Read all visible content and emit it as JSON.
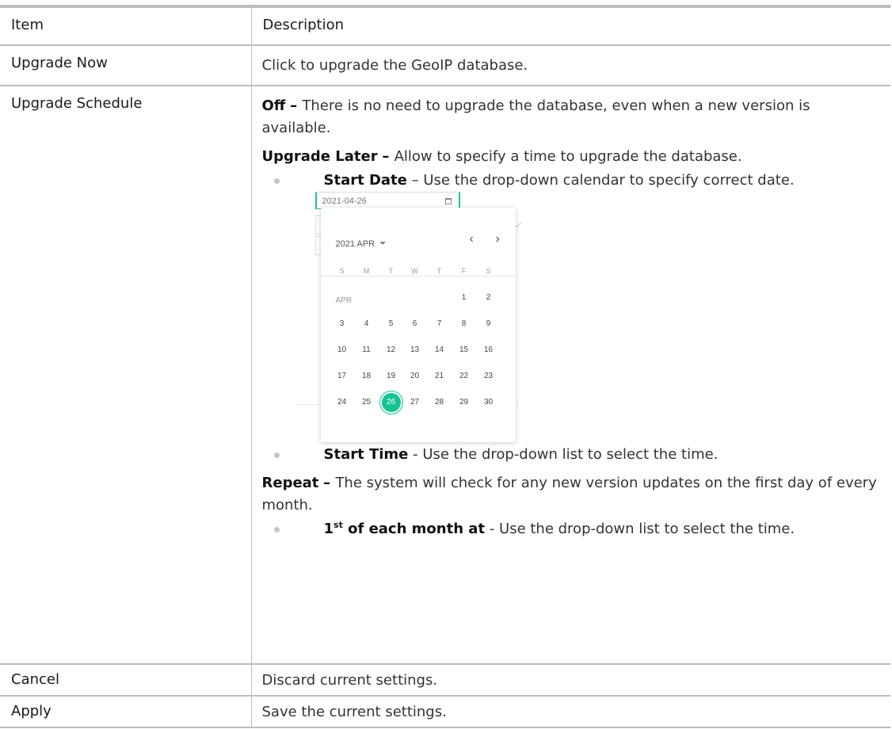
{
  "header": {
    "col_item": "Item",
    "col_description": "Description"
  },
  "rows": {
    "upgrade_now": {
      "item": "Upgrade Now",
      "desc": "Click to upgrade the GeoIP database."
    },
    "upgrade_schedule": {
      "item": "Upgrade Schedule",
      "off_label": "Off",
      "off_text": "There is no need to upgrade the database, even when a new version is available.",
      "later_label": "Upgrade Later",
      "later_text": "Allow to specify a time to upgrade the database.",
      "start_date_label": "Start Date",
      "start_date_text": "Use the drop-down calendar to specify correct date.",
      "start_time_label": "Start Time",
      "start_time_text": "Use the drop-down list to select the time.",
      "repeat_label": "Repeat",
      "repeat_text": "The system will check for any new version updates on the first day of every month.",
      "monthly_label_num": "1",
      "monthly_label_sup": "st",
      "monthly_label_rest": " of each month at",
      "monthly_text": "Use the drop-down list to select the time."
    },
    "cancel": {
      "item": "Cancel",
      "desc": "Discard current settings."
    },
    "apply": {
      "item": "Apply",
      "desc": "Save the current settings."
    }
  },
  "calendar": {
    "input_value": "2021-04-26",
    "header": "2021 APR",
    "weekdays": [
      "S",
      "M",
      "T",
      "W",
      "T",
      "F",
      "S"
    ],
    "month_short": "APR",
    "first_weekday": 3,
    "days_in_month": 30,
    "selected_day": 26,
    "accent": "#16c393",
    "prev_symbol": "‹",
    "next_symbol": "›",
    "icon": "calendar-icon"
  },
  "colors": {
    "rule": "#bdbdbd",
    "accent": "#20c49a",
    "bullet": "#c6c6c6"
  }
}
